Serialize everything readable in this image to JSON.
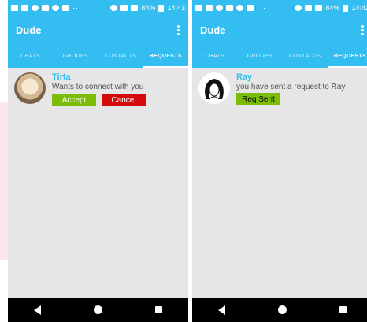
{
  "colors": {
    "primary": "#33bdf0",
    "accept": "#7cbc0a",
    "cancel": "#d40b0b",
    "name": "#33bdf0",
    "background": "#e6e6e6"
  },
  "screens": [
    {
      "status": {
        "percent": "84%",
        "time": "14:43"
      },
      "app_title": "Dude",
      "tabs": [
        "CHATS",
        "GROUPS",
        "CONTACTS",
        "REQUESTS"
      ],
      "active_tab": "REQUESTS",
      "request": {
        "name": "Tirta",
        "message": "Wants to connect with you",
        "accept_label": "Accept",
        "cancel_label": "Cancel"
      }
    },
    {
      "status": {
        "percent": "84%",
        "time": "14:42"
      },
      "app_title": "Dude",
      "tabs": [
        "CHATS",
        "GROUPS",
        "CONTACTS",
        "REQUESTS"
      ],
      "active_tab": "REQUESTS",
      "request": {
        "name": "Ray",
        "message": "you have sent a request to Ray",
        "req_sent_label": "Req Sent"
      }
    }
  ]
}
